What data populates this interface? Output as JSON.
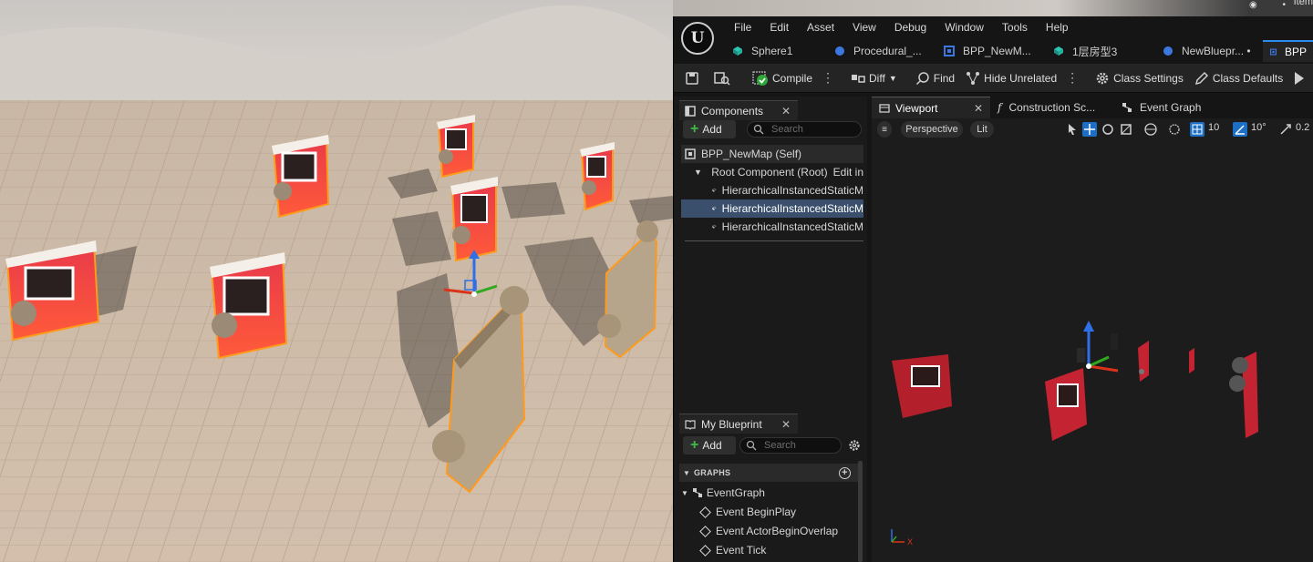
{
  "top_strip": {
    "item_label": "Item"
  },
  "editor": {
    "menu": [
      "File",
      "Edit",
      "Asset",
      "View",
      "Debug",
      "Window",
      "Tools",
      "Help"
    ],
    "doc_tabs": [
      {
        "label": "Sphere1",
        "icon": "static-mesh-icon",
        "color": "#2ec6b4"
      },
      {
        "label": "Procedural_...",
        "icon": "sphere-icon",
        "color": "#3c78e0"
      },
      {
        "label": "BPP_NewM...",
        "icon": "blueprint-icon",
        "color": "#3c78e0"
      },
      {
        "label": "1层房型3",
        "icon": "static-mesh-icon",
        "color": "#2ec6b4"
      },
      {
        "label": "NewBluepr... •",
        "icon": "sphere-icon",
        "color": "#3c78e0"
      },
      {
        "label": "BPP",
        "icon": "blueprint-icon",
        "color": "#3c78e0",
        "active": true
      }
    ],
    "toolbar": {
      "compile": "Compile",
      "diff": "Diff",
      "find": "Find",
      "hide_unrelated": "Hide Unrelated",
      "class_settings": "Class Settings",
      "class_defaults": "Class Defaults"
    },
    "components": {
      "tab_label": "Components",
      "add_label": "Add",
      "search_placeholder": "Search",
      "tree": [
        {
          "label": "BPP_NewMap (Self)"
        },
        {
          "label": "Root Component (Root)",
          "extra": "Edit in"
        },
        {
          "label": "HierarchicalInstancedStaticM"
        },
        {
          "label": "HierarchicalInstancedStaticM",
          "selected": true
        },
        {
          "label": "HierarchicalInstancedStaticM"
        }
      ]
    },
    "viewport_tabs": [
      {
        "label": "Viewport"
      },
      {
        "label": "Construction Sc..."
      },
      {
        "label": "Event Graph"
      }
    ],
    "viewport_toolbar": {
      "perspective": "Perspective",
      "lit": "Lit",
      "grid_snap": "10",
      "rotation_snap": "10°",
      "scale_snap": "0.2"
    },
    "my_blueprint": {
      "tab_label": "My Blueprint",
      "add_label": "Add",
      "search_placeholder": "Search",
      "section": "GRAPHS",
      "graph": "EventGraph",
      "events": [
        "Event BeginPlay",
        "Event ActorBeginOverlap",
        "Event Tick"
      ]
    },
    "axis_labels": {
      "x": "X"
    },
    "colors": {
      "accent": "#2b8cf0",
      "selected": "#3a4f6b",
      "add_plus": "#3dbb46",
      "brick": "#e0323c"
    }
  }
}
